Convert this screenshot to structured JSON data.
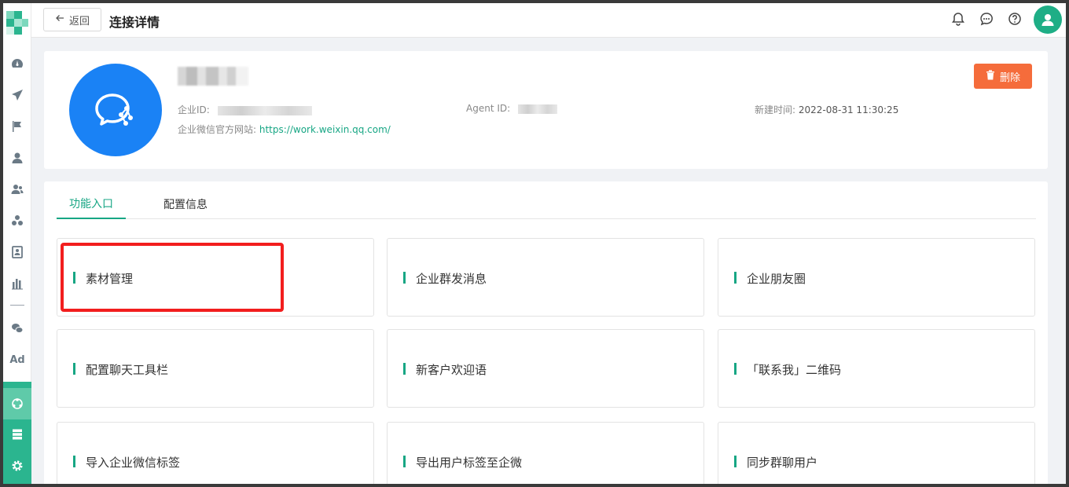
{
  "colors": {
    "accent": "#17a684",
    "sidebar_green": "#2bb58f",
    "delete": "#f56c3b",
    "brand_blue": "#1a82f5",
    "highlight_red": "#f21e1e"
  },
  "topbar": {
    "back_label": "返回",
    "title": "连接详情",
    "icons": [
      "bell-icon",
      "chat-icon",
      "help-icon",
      "user-avatar-icon"
    ]
  },
  "header": {
    "corp_id_label": "企业ID:",
    "agent_id_label": "Agent ID:",
    "created_label": "新建时间:",
    "created_value": "2022-08-31 11:30:25",
    "website_label": "企业微信官方网站:",
    "website_value": "https://work.weixin.qq.com/",
    "delete_label": "删除"
  },
  "tabs": [
    {
      "label": "功能入口",
      "active": true
    },
    {
      "label": "配置信息",
      "active": false
    }
  ],
  "features": [
    {
      "label": "素材管理"
    },
    {
      "label": "企业群发消息"
    },
    {
      "label": "企业朋友圈"
    },
    {
      "label": "配置聊天工具栏"
    },
    {
      "label": "新客户欢迎语"
    },
    {
      "label": "「联系我」二维码"
    },
    {
      "label": "导入企业微信标签"
    },
    {
      "label": "导出用户标签至企微"
    },
    {
      "label": "同步群聊用户"
    }
  ],
  "sidebar": {
    "ad_label": "Ad",
    "icons": [
      "dashboard-icon",
      "send-icon",
      "flag-icon",
      "user-icon",
      "user-group-icon",
      "team-icon",
      "contact-card-icon",
      "bar-chart-icon",
      "wechat-icon",
      "ad-icon",
      "connection-icon",
      "server-icon",
      "settings-icon"
    ]
  }
}
